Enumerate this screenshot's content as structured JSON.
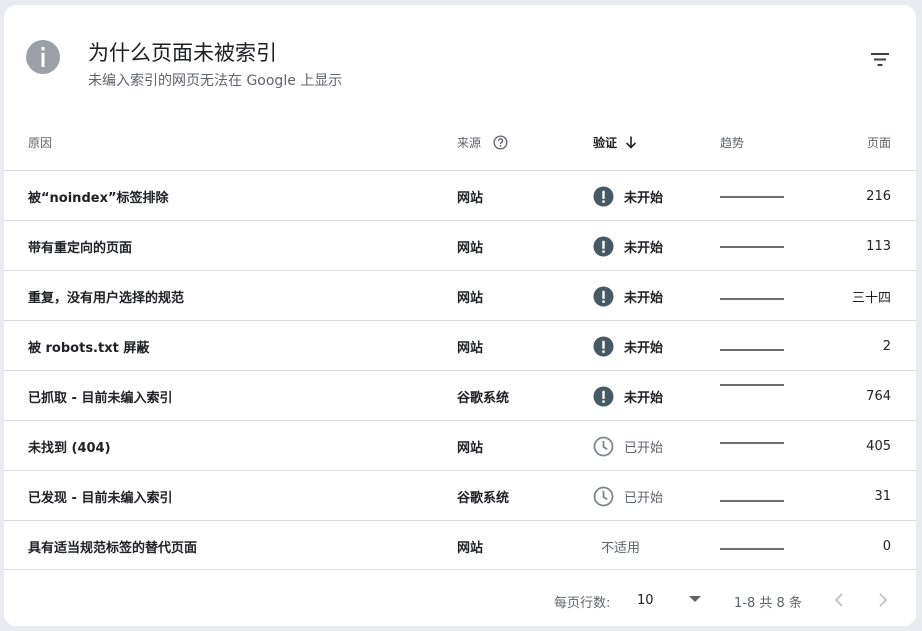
{
  "header": {
    "title": "为什么页面未被索引",
    "subtitle": "未编入索引的网页无法在 Google 上显示",
    "icons": {
      "info": "info-icon",
      "filter": "filter-icon"
    }
  },
  "columns": {
    "reason": "原因",
    "source": "来源",
    "verify": "验证",
    "trend": "趋势",
    "pages": "页面"
  },
  "rows": [
    {
      "reason": "被“noindex”标签排除",
      "source": "网站",
      "status": "未开始",
      "status_type": "not-started",
      "pages": "216"
    },
    {
      "reason": "带有重定向的页面",
      "source": "网站",
      "status": "未开始",
      "status_type": "not-started",
      "pages": "113"
    },
    {
      "reason": "重复，没有用户选择的规范",
      "source": "网站",
      "status": "未开始",
      "status_type": "not-started",
      "pages": "三十四"
    },
    {
      "reason": "被 robots.txt 屏蔽",
      "source": "网站",
      "status": "未开始",
      "status_type": "not-started",
      "pages": "2"
    },
    {
      "reason": "已抓取 - 目前未编入索引",
      "source": "谷歌系统",
      "status": "未开始",
      "status_type": "not-started",
      "pages": "764"
    },
    {
      "reason": "未找到 (404)",
      "source": "网站",
      "status": "已开始",
      "status_type": "started",
      "pages": "405"
    },
    {
      "reason": "已发现 - 目前未编入索引",
      "source": "谷歌系统",
      "status": "已开始",
      "status_type": "started",
      "pages": "31"
    },
    {
      "reason": "具有适当规范标签的替代页面",
      "source": "网站",
      "status": "不适用",
      "status_type": "na",
      "pages": "0"
    }
  ],
  "pagination": {
    "rows_per_page_label": "每页行数:",
    "rows_per_page": "10",
    "range": "1-8 共 8 条"
  },
  "colors": {
    "status_dark": "#455a64",
    "status_grey": "#80868b",
    "trend_line": "#3c4043",
    "divider": "#dadce0"
  }
}
